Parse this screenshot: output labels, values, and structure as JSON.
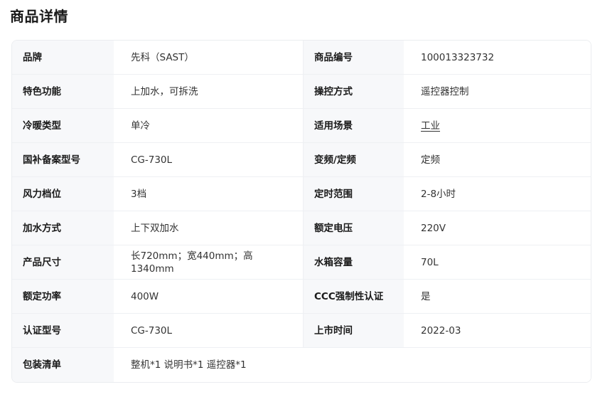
{
  "header": {
    "title": "商品详情"
  },
  "specs": {
    "rows": [
      {
        "label1": "品牌",
        "value1": "先科（SAST）",
        "label2": "商品编号",
        "value2": "100013323732"
      },
      {
        "label1": "特色功能",
        "value1": "上加水，可拆洗",
        "label2": "操控方式",
        "value2": "遥控器控制"
      },
      {
        "label1": "冷暖类型",
        "value1": "单冷",
        "label2": "适用场景",
        "value2": "工业"
      },
      {
        "label1": "国补备案型号",
        "value1": "CG-730L",
        "label2": "变频/定频",
        "value2": "定频"
      },
      {
        "label1": "风力档位",
        "value1": "3档",
        "label2": "定时范围",
        "value2": "2-8小时"
      },
      {
        "label1": "加水方式",
        "value1": "上下双加水",
        "label2": "额定电压",
        "value2": "220V"
      },
      {
        "label1": "产品尺寸",
        "value1": "长720mm；宽440mm；高1340mm",
        "label2": "水箱容量",
        "value2": "70L"
      },
      {
        "label1": "额定功率",
        "value1": "400W",
        "label2": "CCC强制性认证",
        "value2": "是"
      },
      {
        "label1": "认证型号",
        "value1": "CG-730L",
        "label2": "上市时间",
        "value2": "2022-03"
      }
    ],
    "last_row": {
      "label": "包装清单",
      "value": "整机*1 说明书*1 遥控器*1"
    }
  },
  "colors": {
    "label_bg": "#f7f8fa",
    "border": "#eef0f3",
    "text": "#1a1a1a"
  }
}
